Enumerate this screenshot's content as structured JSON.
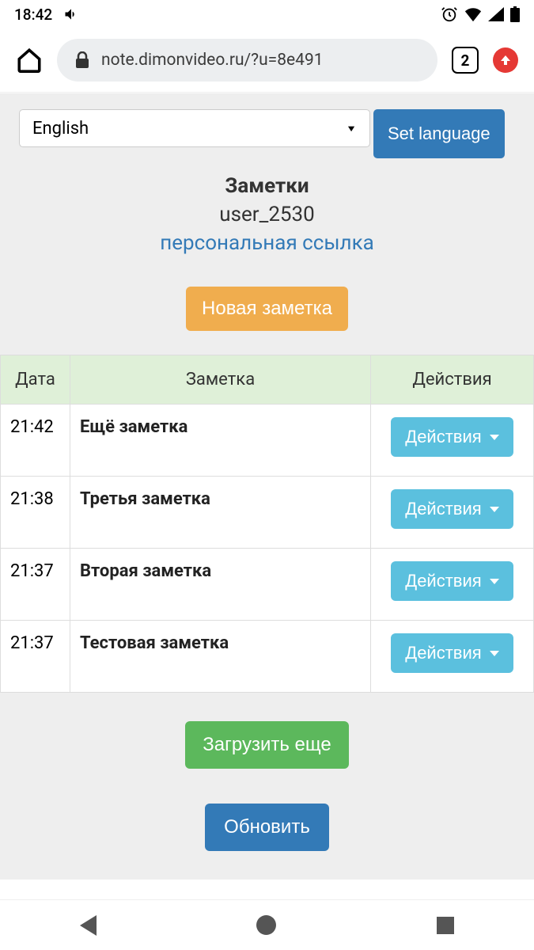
{
  "status": {
    "time": "18:42"
  },
  "chrome": {
    "url": "note.dimonvideo.ru/?u=8e491",
    "tabs": "2"
  },
  "lang": {
    "selected": "English",
    "setBtn": "Set language"
  },
  "header": {
    "title": "Заметки",
    "user": "user_2530",
    "link": "персональная ссылка"
  },
  "buttons": {
    "newNote": "Новая заметка",
    "loadMore": "Загрузить еще",
    "refresh": "Обновить",
    "actions": "Действия"
  },
  "table": {
    "col_date": "Дата",
    "col_note": "Заметка",
    "col_actions": "Действия",
    "rows": [
      {
        "time": "21:42",
        "note": "Ещё заметка"
      },
      {
        "time": "21:38",
        "note": "Третья заметка"
      },
      {
        "time": "21:37",
        "note": "Вторая заметка"
      },
      {
        "time": "21:37",
        "note": "Тестовая заметка"
      }
    ]
  }
}
